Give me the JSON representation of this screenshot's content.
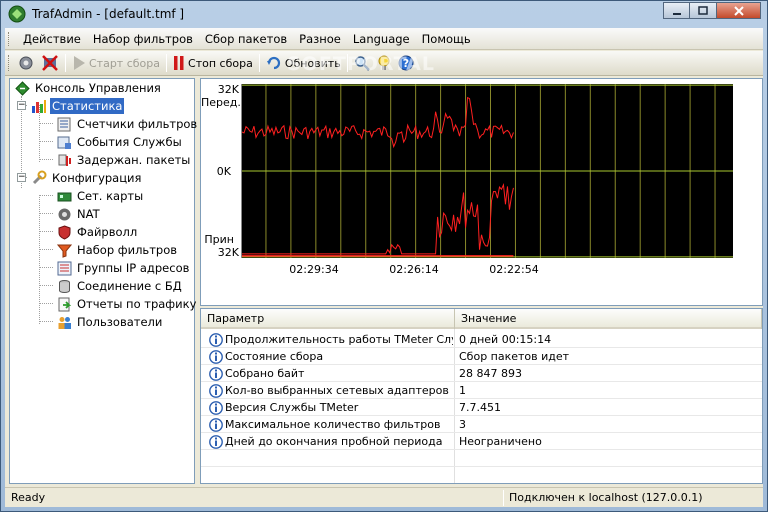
{
  "window": {
    "title": "TrafAdmin - [default.tmf ]"
  },
  "menu": [
    "Действие",
    "Набор фильтров",
    "Сбор пакетов",
    "Разное",
    "Language",
    "Помощь"
  ],
  "toolbar": {
    "start_label": "Старт сбора",
    "stop_label": "Стоп сбора",
    "refresh_label": "Обновить",
    "watermark": "SOFTPORTAL"
  },
  "tree": {
    "root": "Консоль Управления",
    "stats": "Статистика",
    "stats_children": [
      "Счетчики фильтров",
      "События Службы",
      "Задержан. пакеты"
    ],
    "config": "Конфигурация",
    "config_children": [
      "Сет. карты",
      "NAT",
      "Файрволл",
      "Набор фильтров",
      "Группы IP адресов",
      "Соединение с БД",
      "Отчеты по трафику",
      "Пользователи"
    ]
  },
  "graph": {
    "top_value": "32K",
    "top_label": "Перед.",
    "mid_value": "0K",
    "bottom_label": "Прин",
    "bottom_value": "32K",
    "time_ticks": [
      "02:29:34",
      "02:26:14",
      "02:22:54"
    ],
    "colors": {
      "background": "#000000",
      "grid": "#8a8a2a",
      "axis": "#a8c830",
      "line": "#ff2020"
    }
  },
  "table": {
    "headers": [
      "Параметр",
      "Значение"
    ],
    "rows": [
      [
        "Продолжительность работы TMeter Служ...",
        "0 дней 00:15:14"
      ],
      [
        "Состояние сбора",
        "Сбор пакетов идет"
      ],
      [
        "Собрано байт",
        "28 847 893"
      ],
      [
        "Кол-во выбранных сетевых адаптеров",
        "1"
      ],
      [
        "Версия Службы TMeter",
        "7.7.451"
      ],
      [
        "Максимальное количество фильтров",
        "3"
      ],
      [
        "Дней до окончания пробной периода",
        "Неограничено"
      ]
    ]
  },
  "status": {
    "left": "Ready",
    "right": "Подключен к localhost (127.0.0.1)"
  }
}
